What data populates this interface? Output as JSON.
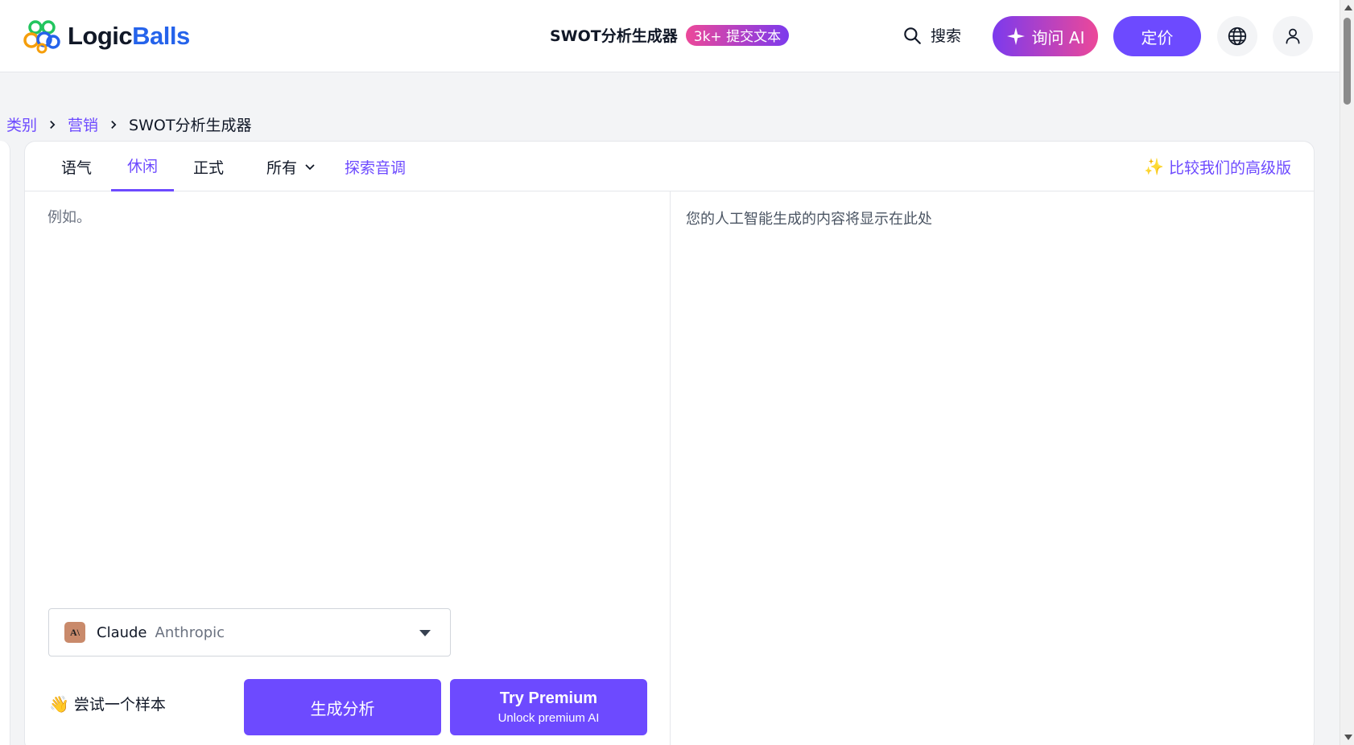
{
  "header": {
    "logo_text_a": "Logic",
    "logo_text_b": "Balls",
    "tool_name": "SWOT分析生成器",
    "badge": "3k+ 提交文本",
    "search_label": "搜索",
    "ask_ai_label": "询问 AI",
    "pricing_label": "定价"
  },
  "breadcrumb": {
    "items": [
      "类别",
      "营销"
    ],
    "current": "SWOT分析生成器"
  },
  "tabs": {
    "tone_label": "语气",
    "items": [
      "休闲",
      "正式"
    ],
    "all_label": "所有",
    "explore_label": "探索音调",
    "active": "休闲",
    "compare_label": "比较我们的高级版",
    "compare_icon": "✨"
  },
  "editor": {
    "placeholder": "例如。",
    "value": ""
  },
  "model": {
    "icon_text": "A\\",
    "name": "Claude",
    "vendor": "Anthropic"
  },
  "actions": {
    "try_sample_icon": "👋",
    "try_sample": "尝试一个样本",
    "generate": "生成分析",
    "premium_title": "Try Premium",
    "premium_sub": "Unlock premium AI"
  },
  "output": {
    "placeholder": "您的人工智能生成的内容将显示在此处"
  },
  "colors": {
    "accent": "#6d4aff",
    "badge_gradient": [
      "#ec4899",
      "#7c3aed"
    ],
    "ask_ai_gradient": [
      "#7c3aed",
      "#ec4899"
    ],
    "logo_blue": "#2563eb"
  }
}
